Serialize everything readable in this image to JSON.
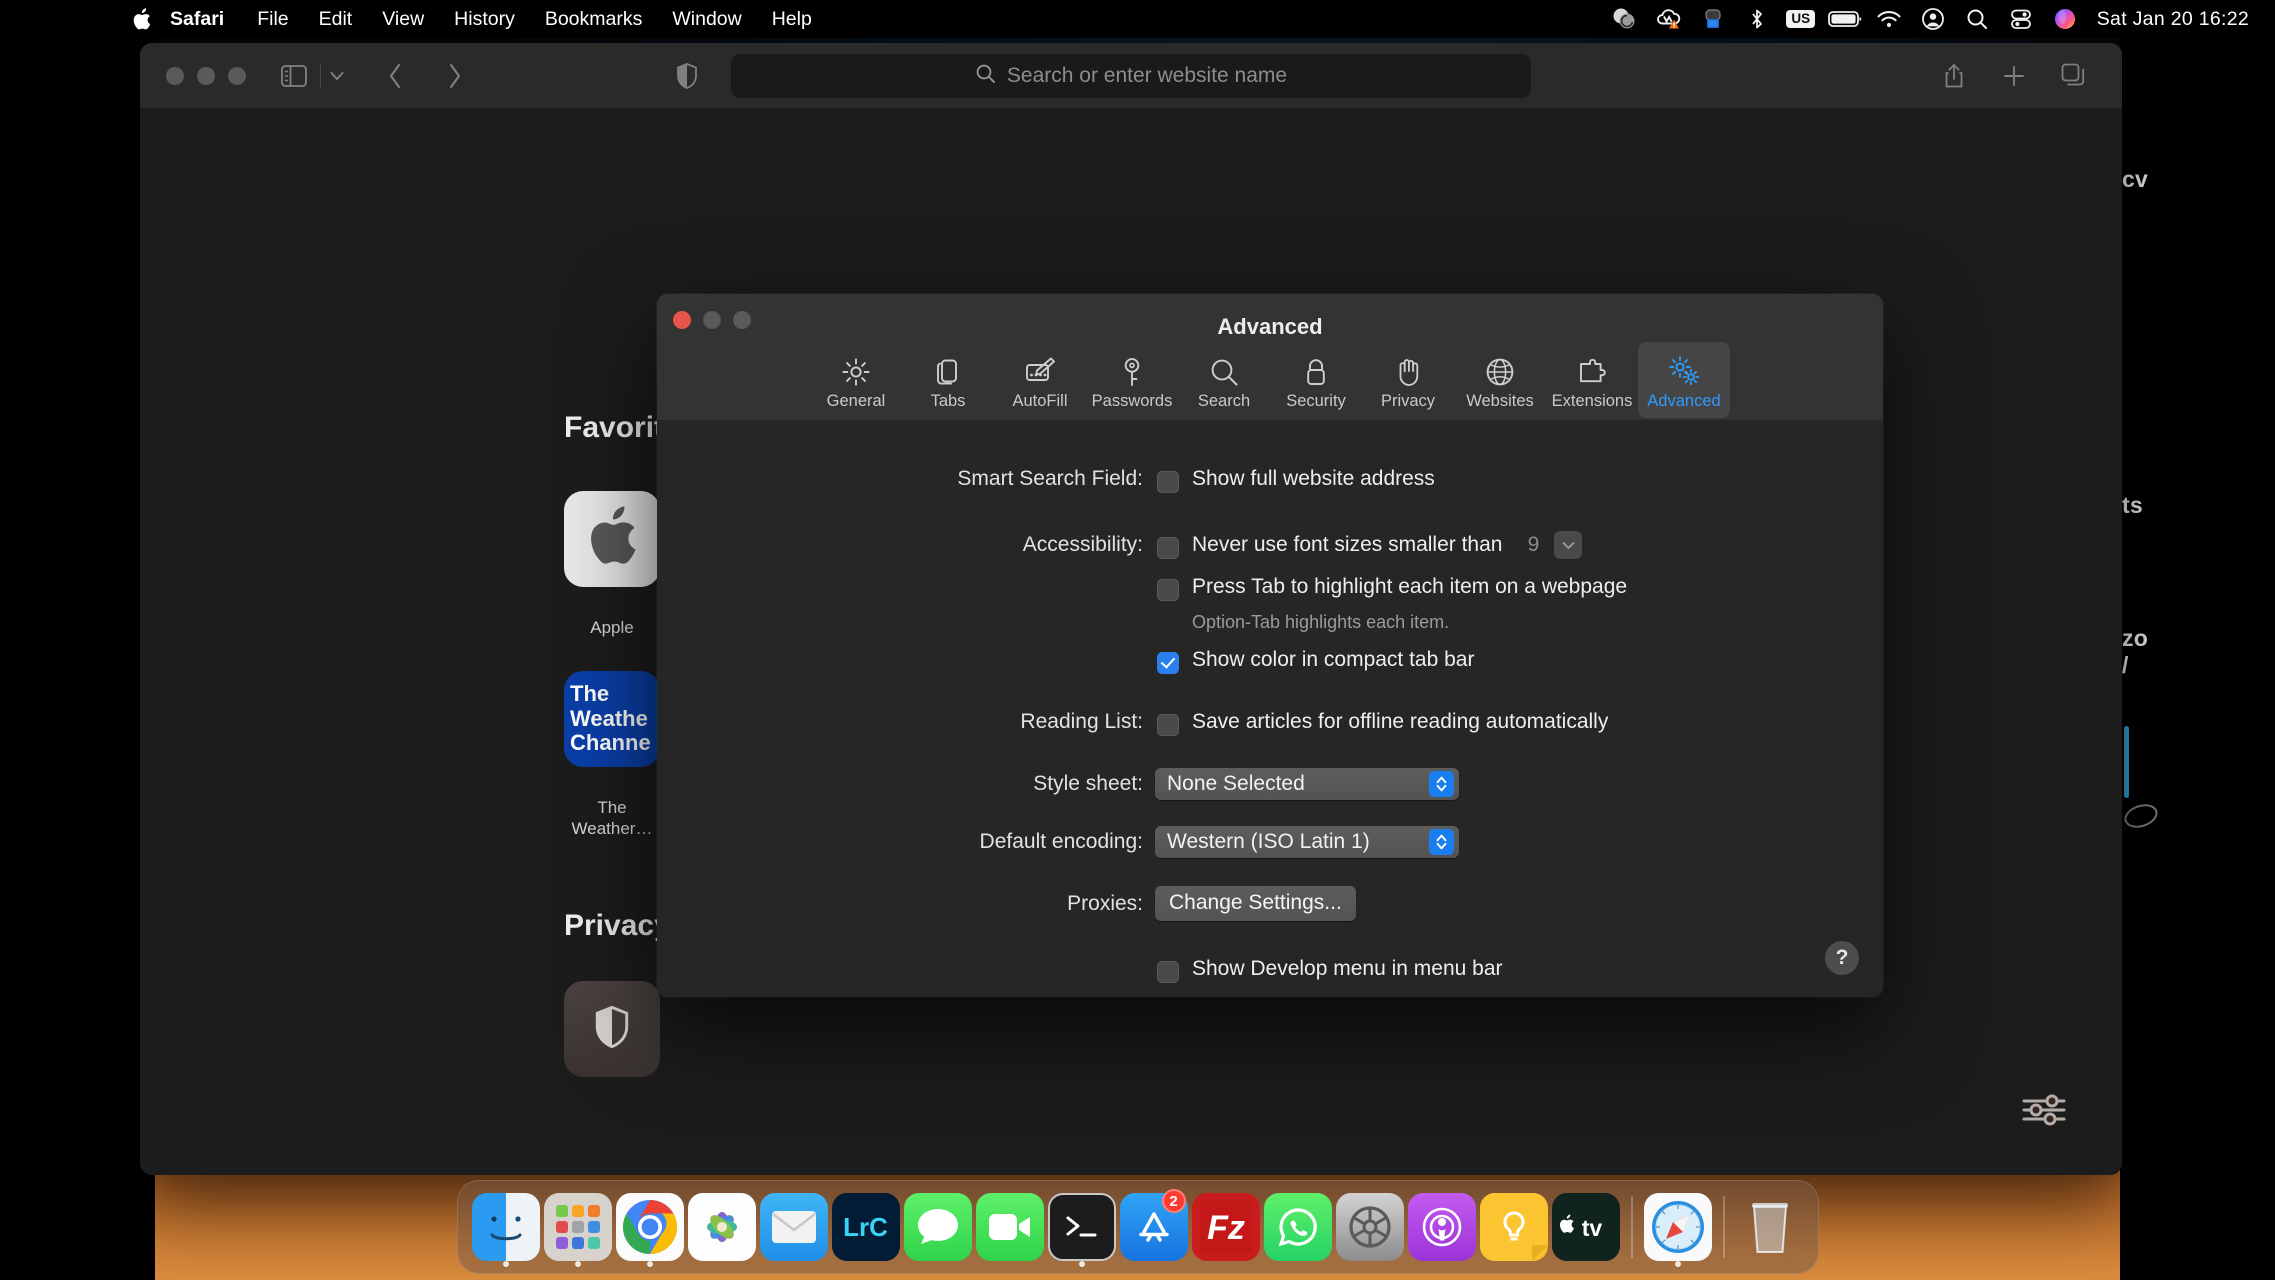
{
  "menubar": {
    "apple_icon": "apple-logo-icon",
    "items": [
      {
        "label": "Safari",
        "bold": true
      },
      {
        "label": "File",
        "bold": false
      },
      {
        "label": "Edit",
        "bold": false
      },
      {
        "label": "View",
        "bold": false
      },
      {
        "label": "History",
        "bold": false
      },
      {
        "label": "Bookmarks",
        "bold": false
      },
      {
        "label": "Window",
        "bold": false
      },
      {
        "label": "Help",
        "bold": false
      }
    ],
    "tray": [
      {
        "name": "dropbox-sync-icon"
      },
      {
        "name": "onedrive-warning-icon"
      },
      {
        "name": "backup-drive-icon"
      },
      {
        "name": "bluetooth-icon"
      },
      {
        "name": "keyboard-input-icon",
        "text": "US"
      },
      {
        "name": "battery-icon"
      },
      {
        "name": "wifi-icon"
      },
      {
        "name": "user-account-icon"
      },
      {
        "name": "spotlight-search-icon"
      },
      {
        "name": "control-center-icon"
      },
      {
        "name": "siri-icon"
      }
    ],
    "clock": "Sat Jan 20  16:22"
  },
  "safari": {
    "toolbar": {
      "sidebar_icon": "sidebar-toggle-icon",
      "sidebar_chevron": "chevron-down-icon",
      "back_icon": "chevron-left-icon",
      "forward_icon": "chevron-right-icon",
      "shield_icon": "privacy-shield-icon",
      "share_icon": "share-icon",
      "newtab_icon": "plus-icon",
      "tabs_icon": "tab-overview-icon"
    },
    "address_bar": {
      "placeholder": "Search or enter website name",
      "value": "",
      "search_icon": "search-icon"
    },
    "start_page": {
      "favorites_heading": "Favorites",
      "privacy_heading": "Privacy Report",
      "favorites": [
        {
          "label": "Apple",
          "icon": "apple-favicon",
          "bg": "#e9e9e9"
        },
        {
          "label": "The Weather…",
          "icon": "weather-channel-favicon",
          "bg": "#0a3fa8",
          "text": "The Weather Channel"
        }
      ],
      "privacy_tile_icon": "privacy-shield-icon",
      "settings_icon": "sliders-icon"
    }
  },
  "desktop": {
    "fragments": [
      "cv",
      "ts",
      "zo",
      "/"
    ]
  },
  "prefs": {
    "title": "Advanced",
    "window_controls": [
      "close-button",
      "minimize-button",
      "zoom-button"
    ],
    "accent_color": "#2d9cff",
    "tabs": [
      {
        "label": "General",
        "icon": "gear-icon",
        "active": false
      },
      {
        "label": "Tabs",
        "icon": "tabs-icon",
        "active": false
      },
      {
        "label": "AutoFill",
        "icon": "autofill-pencil-icon",
        "active": false
      },
      {
        "label": "Passwords",
        "icon": "key-icon",
        "active": false
      },
      {
        "label": "Search",
        "icon": "magnifier-icon",
        "active": false
      },
      {
        "label": "Security",
        "icon": "lock-icon",
        "active": false
      },
      {
        "label": "Privacy",
        "icon": "hand-icon",
        "active": false
      },
      {
        "label": "Websites",
        "icon": "globe-icon",
        "active": false
      },
      {
        "label": "Extensions",
        "icon": "puzzle-piece-icon",
        "active": false
      },
      {
        "label": "Advanced",
        "icon": "gears-icon",
        "active": true
      }
    ],
    "rows": {
      "smart_search_label": "Smart Search Field:",
      "smart_search_checkbox": "Show full website address",
      "smart_search_checked": false,
      "accessibility_label": "Accessibility:",
      "font_size_checkbox": "Never use font sizes smaller than",
      "font_size_checked": false,
      "font_size_value": "9",
      "font_size_chevron": "chevron-down-icon",
      "press_tab_checkbox": "Press Tab to highlight each item on a webpage",
      "press_tab_checked": false,
      "press_tab_hint": "Option-Tab highlights each item.",
      "compact_tab_checkbox": "Show color in compact tab bar",
      "compact_tab_checked": true,
      "reading_list_label": "Reading List:",
      "reading_list_checkbox": "Save articles for offline reading automatically",
      "reading_list_checked": false,
      "style_sheet_label": "Style sheet:",
      "style_sheet_value": "None Selected",
      "encoding_label": "Default encoding:",
      "encoding_value": "Western (ISO Latin 1)",
      "proxies_label": "Proxies:",
      "proxies_button": "Change Settings...",
      "develop_checkbox": "Show Develop menu in menu bar",
      "develop_checked": false
    },
    "help_button": "?"
  },
  "dock": {
    "items": [
      {
        "name": "finder",
        "label": "Finder",
        "running": true
      },
      {
        "name": "launchpad",
        "label": "Launchpad",
        "running": false
      },
      {
        "name": "chrome",
        "label": "Google Chrome",
        "running": true
      },
      {
        "name": "photos",
        "label": "Photos",
        "running": false
      },
      {
        "name": "mail",
        "label": "Mail",
        "running": false
      },
      {
        "name": "lightroom-classic",
        "label": "LrC",
        "running": false
      },
      {
        "name": "messages",
        "label": "Messages",
        "running": false
      },
      {
        "name": "facetime",
        "label": "FaceTime",
        "running": false
      },
      {
        "name": "terminal",
        "label": "Terminal",
        "running": true
      },
      {
        "name": "app-store",
        "label": "App Store",
        "badge": "2",
        "running": false
      },
      {
        "name": "filezilla",
        "label": "FileZilla",
        "running": false
      },
      {
        "name": "whatsapp",
        "label": "WhatsApp",
        "running": false
      },
      {
        "name": "system-preferences",
        "label": "System Preferences",
        "running": false
      },
      {
        "name": "podcasts",
        "label": "Podcasts",
        "running": false
      },
      {
        "name": "notes",
        "label": "Notes",
        "running": false
      },
      {
        "name": "apple-tv",
        "label": "Apple TV",
        "running": false
      },
      {
        "name": "safari",
        "label": "Safari",
        "running": true
      },
      {
        "name": "trash",
        "label": "Trash",
        "running": false
      }
    ]
  }
}
